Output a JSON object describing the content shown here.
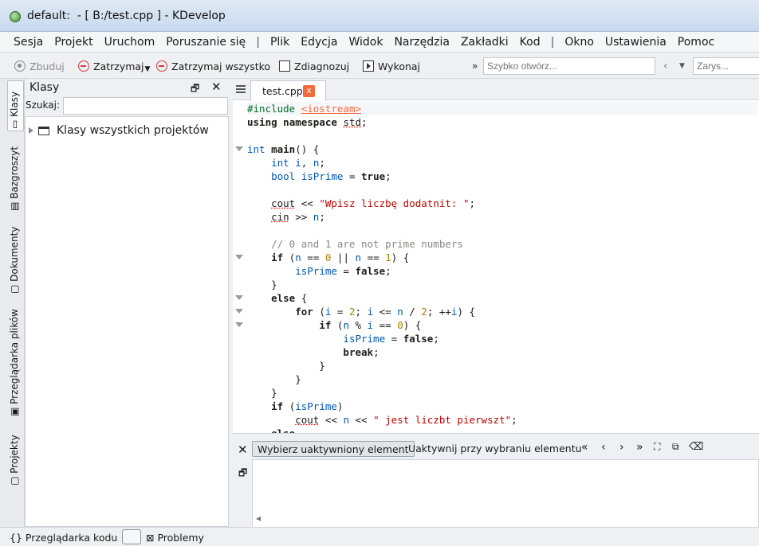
{
  "window": {
    "title": "default:  - [ B:/test.cpp ] - KDevelop"
  },
  "menu": {
    "items": [
      "Sesja",
      "Projekt",
      "Uruchom",
      "Poruszanie się",
      "|",
      "Plik",
      "Edycja",
      "Widok",
      "Narzędzia",
      "Zakładki",
      "Kod",
      "|",
      "Okno",
      "Ustawienia",
      "Pomoc"
    ]
  },
  "toolbar": {
    "build": "Zbuduj",
    "stop": "Zatrzymaj",
    "stop_all": "Zatrzymaj wszystko",
    "debug": "Zdiagnozuj",
    "execute": "Wykonaj",
    "overflow": "»",
    "quick_open_placeholder": "Szybko otwórz...",
    "outline_placeholder": "Zarys..."
  },
  "left_tabs": [
    "Klasy",
    "Bazgroszyt",
    "Dokumenty",
    "Przeglądarka plików",
    "Projekty"
  ],
  "class_panel": {
    "title": "Klasy",
    "search_label": "Szukaj:",
    "search_value": "",
    "tree_root": "Klasy wszystkich projektów"
  },
  "editor": {
    "tab_label": "test.cpp",
    "tab_close": "x",
    "lines": [
      "#include <iostream>",
      "using namespace std;",
      "",
      "int main() {",
      "    int i, n;",
      "    bool isPrime = true;",
      "",
      "    cout << \"Wpisz liczbę dodatnit: \";",
      "    cin >> n;",
      "",
      "    // 0 and 1 are not prime numbers",
      "    if (n == 0 || n == 1) {",
      "        isPrime = false;",
      "    }",
      "    else {",
      "        for (i = 2; i <= n / 2; ++i) {",
      "            if (n % i == 0) {",
      "                isPrime = false;",
      "                break;",
      "            }",
      "        }",
      "    }",
      "    if (isPrime)",
      "        cout << n << \" jest liczbt pierwszt\";",
      "    else"
    ]
  },
  "bottom_panel": {
    "select_active": "Wybierz uaktywniony element",
    "activate_on_select": "Uaktywnij przy wybraniu elementu",
    "nav_first": "|<<",
    "nav_prev": "<",
    "nav_next": ">",
    "nav_last": ">>|"
  },
  "statusbar": {
    "code_browser": "{} Przeglądarka kodu",
    "problems": "Problemy"
  }
}
